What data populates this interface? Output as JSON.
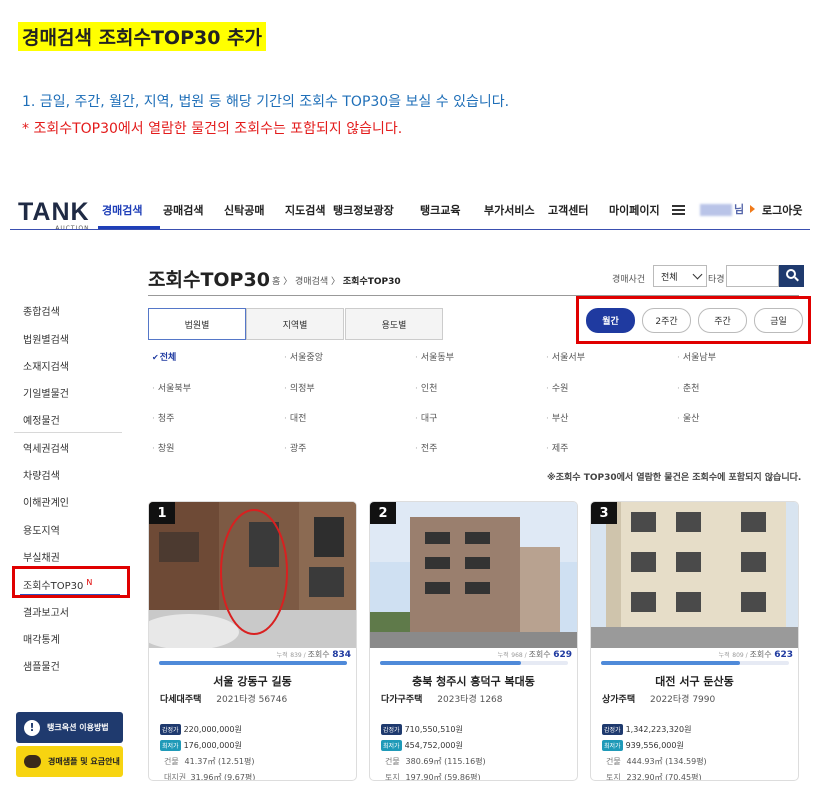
{
  "announcement": {
    "title": "경매검색 조회수TOP30 추가",
    "line1": "1.  금일, 주간, 월간, 지역, 법원 등 해당 기간의 조회수 TOP30을 보실 수 있습니다.",
    "line2": "* 조회수TOP30에서 열람한 물건의 조회수는 포함되지 않습니다."
  },
  "header": {
    "logo": "TANK",
    "logo_sub": "AUCTION",
    "nav": [
      "경매검색",
      "공매검색",
      "신탁공매",
      "지도검색",
      "탱크정보광장",
      "탱크교육",
      "부가서비스",
      "고객센터",
      "마이페이지"
    ],
    "user_suffix": "님",
    "logout": "로그아웃"
  },
  "sidebar": {
    "items": [
      "종합검색",
      "법원별검색",
      "소재지검색",
      "기일별물건",
      "예정물건",
      "역세권검색",
      "차량검색",
      "이해관계인",
      "용도지역",
      "부실채권",
      "조회수TOP30",
      "결과보고서",
      "매각통계",
      "샘플물건"
    ],
    "new_badge": "N",
    "guide1": "탱크옥션 이용방법",
    "guide2": "경매샘플 및 요금안내"
  },
  "page": {
    "title": "조회수TOP30",
    "breadcrumb_home": "홈",
    "breadcrumb_mid": "경매검색",
    "breadcrumb_current": "조회수TOP30",
    "search_label": "경매사건",
    "select_value": "전체",
    "tagyeong": "타경"
  },
  "tabs": [
    "법원별",
    "지역별",
    "용도별"
  ],
  "periods": [
    "월간",
    "2주간",
    "주간",
    "금일"
  ],
  "courts": [
    [
      "전체",
      "서울중앙",
      "서울동부",
      "서울서부",
      "서울남부"
    ],
    [
      "서울북부",
      "의정부",
      "인천",
      "수원",
      "춘천"
    ],
    [
      "청주",
      "대전",
      "대구",
      "부산",
      "울산"
    ],
    [
      "창원",
      "광주",
      "전주",
      "제주"
    ]
  ],
  "notice": "※조회수 TOP30에서 열람한 물건은 조회수에 포함되지 않습니다.",
  "cards": [
    {
      "rank": "1",
      "cumulative_label": "누적",
      "cumulative": "839",
      "views_label": "조회수",
      "views": "834",
      "views_ratio": 1.0,
      "address": "서울 강동구 길동",
      "type": "다세대주택",
      "case": "2021타경 56746",
      "appraisal_tag": "감정가",
      "appraisal": "220,000,000원",
      "min_tag": "최저가",
      "min": "176,000,000원",
      "area1_label": "건물",
      "area1": "41.37㎡ (12.51평)",
      "area2_label": "대지권",
      "area2": "31.96㎡ (9.67평)"
    },
    {
      "rank": "2",
      "cumulative_label": "누적",
      "cumulative": "968",
      "views_label": "조회수",
      "views": "629",
      "views_ratio": 0.75,
      "address": "충북 청주시 흥덕구 복대동",
      "type": "다가구주택",
      "case": "2023타경 1268",
      "appraisal_tag": "감정가",
      "appraisal": "710,550,510원",
      "min_tag": "최저가",
      "min": "454,752,000원",
      "area1_label": "건물",
      "area1": "380.69㎡ (115.16평)",
      "area2_label": "토지",
      "area2": "197.90㎡ (59.86평)"
    },
    {
      "rank": "3",
      "cumulative_label": "누적",
      "cumulative": "809",
      "views_label": "조회수",
      "views": "623",
      "views_ratio": 0.74,
      "address": "대전 서구 둔산동",
      "type": "상가주택",
      "case": "2022타경 7990",
      "appraisal_tag": "감정가",
      "appraisal": "1,342,223,320원",
      "min_tag": "최저가",
      "min": "939,556,000원",
      "area1_label": "건물",
      "area1": "444.93㎡ (134.59평)",
      "area2_label": "토지",
      "area2": "232.90㎡ (70.45평)"
    }
  ]
}
